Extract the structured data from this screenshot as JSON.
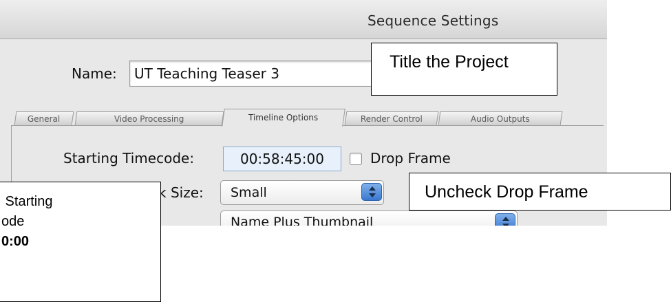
{
  "window": {
    "title": "Sequence Settings"
  },
  "name_row": {
    "label": "Name:",
    "value": "UT Teaching Teaser 3"
  },
  "tabs": [
    {
      "label": "General",
      "active": false
    },
    {
      "label": "Video Processing",
      "active": false
    },
    {
      "label": "Timeline Options",
      "active": true
    },
    {
      "label": "Render Control",
      "active": false
    },
    {
      "label": "Audio Outputs",
      "active": false
    }
  ],
  "timeline_options": {
    "starting_timecode_label": "Starting Timecode:",
    "starting_timecode_value": "00:58:45:00",
    "drop_frame_label": "Drop Frame",
    "drop_frame_checked": false,
    "track_size_label": "k Size:",
    "track_size_value": "Small",
    "thumbnail_label": "...",
    "thumbnail_value": "Name Plus Thumbnail"
  },
  "annotations": {
    "title_project": "Title the Project",
    "uncheck_drop_frame": "Uncheck Drop Frame",
    "starting_line1": " Starting",
    "starting_line2": "ode",
    "starting_line3": "0:00"
  },
  "colors": {
    "window_bg": "#e8e8e8",
    "timecode_field_bg": "#e7f0fb",
    "popup_stepper": "#3a78d0"
  }
}
